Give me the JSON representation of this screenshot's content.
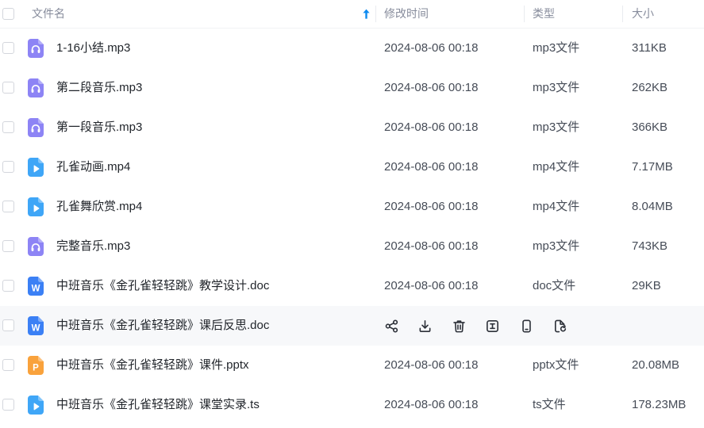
{
  "colors": {
    "sort_accent": "#0d8af0",
    "row_hover_bg": "#f7f8fa",
    "audio_icon": "#8d84f5",
    "video_icon": "#3fa6f7",
    "word_icon": "#3b80f5",
    "ppt_icon": "#f9a23c"
  },
  "header": {
    "select_all_checked": false,
    "sort_icon": "arrow-up-icon",
    "columns": {
      "name": "文件名",
      "modified": "修改时间",
      "type": "类型",
      "size": "大小"
    }
  },
  "rows": [
    {
      "selected": false,
      "file_icon": "audio-file-icon",
      "name": "1-16小结.mp3",
      "modified": "2024-08-06 00:18",
      "type": "mp3文件",
      "size": "311KB"
    },
    {
      "selected": false,
      "file_icon": "audio-file-icon",
      "name": "第二段音乐.mp3",
      "modified": "2024-08-06 00:18",
      "type": "mp3文件",
      "size": "262KB"
    },
    {
      "selected": false,
      "file_icon": "audio-file-icon",
      "name": "第一段音乐.mp3",
      "modified": "2024-08-06 00:18",
      "type": "mp3文件",
      "size": "366KB"
    },
    {
      "selected": false,
      "file_icon": "video-file-icon",
      "name": "孔雀动画.mp4",
      "modified": "2024-08-06 00:18",
      "type": "mp4文件",
      "size": "7.17MB"
    },
    {
      "selected": false,
      "file_icon": "video-file-icon",
      "name": "孔雀舞欣赏.mp4",
      "modified": "2024-08-06 00:18",
      "type": "mp4文件",
      "size": "8.04MB"
    },
    {
      "selected": false,
      "file_icon": "audio-file-icon",
      "name": "完整音乐.mp3",
      "modified": "2024-08-06 00:18",
      "type": "mp3文件",
      "size": "743KB"
    },
    {
      "selected": false,
      "file_icon": "word-file-icon",
      "badge": "W",
      "name": "中班音乐《金孔雀轻轻跳》教学设计.doc",
      "modified": "2024-08-06 00:18",
      "type": "doc文件",
      "size": "29KB"
    },
    {
      "selected": false,
      "file_icon": "word-file-icon",
      "badge": "W",
      "name": "中班音乐《金孔雀轻轻跳》课后反思.doc",
      "hovered": true,
      "actions": [
        "share-icon",
        "download-icon",
        "delete-icon",
        "rename-icon",
        "mobile-phone-icon",
        "file-sync-icon"
      ]
    },
    {
      "selected": false,
      "file_icon": "ppt-file-icon",
      "badge": "P",
      "name": "中班音乐《金孔雀轻轻跳》课件.pptx",
      "modified": "2024-08-06 00:18",
      "type": "pptx文件",
      "size": "20.08MB"
    },
    {
      "selected": false,
      "file_icon": "video-file-icon",
      "name": "中班音乐《金孔雀轻轻跳》课堂实录.ts",
      "modified": "2024-08-06 00:18",
      "type": "ts文件",
      "size": "178.23MB"
    }
  ]
}
